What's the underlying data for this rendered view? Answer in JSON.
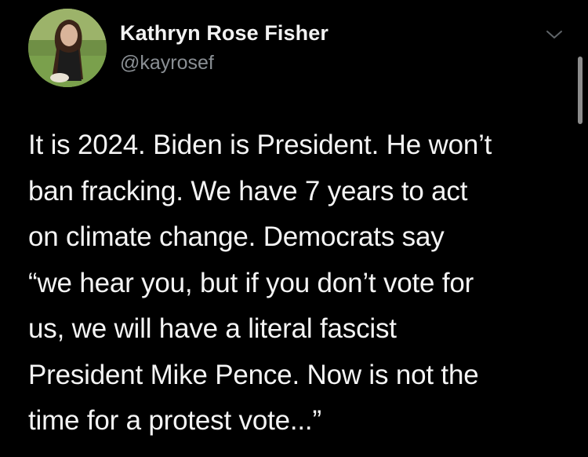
{
  "tweet": {
    "author": {
      "display_name": "Kathryn Rose Fisher",
      "handle": "@kayrosef",
      "avatar_icon": "profile-photo"
    },
    "more_icon": "chevron-down-icon",
    "text_lines": [
      "It is 2024. Biden is President. He won’t",
      "ban fracking. We have 7 years to act",
      "on climate change. Democrats say",
      "“we hear you, but if you don’t vote for",
      "us, we will have a literal fascist",
      "President Mike Pence. Now is not the",
      "time for a protest vote...”"
    ]
  },
  "colors": {
    "background": "#000000",
    "name_text": "#f2f2f2",
    "handle_text": "#8a8f94",
    "body_text": "#f4f4f4"
  }
}
